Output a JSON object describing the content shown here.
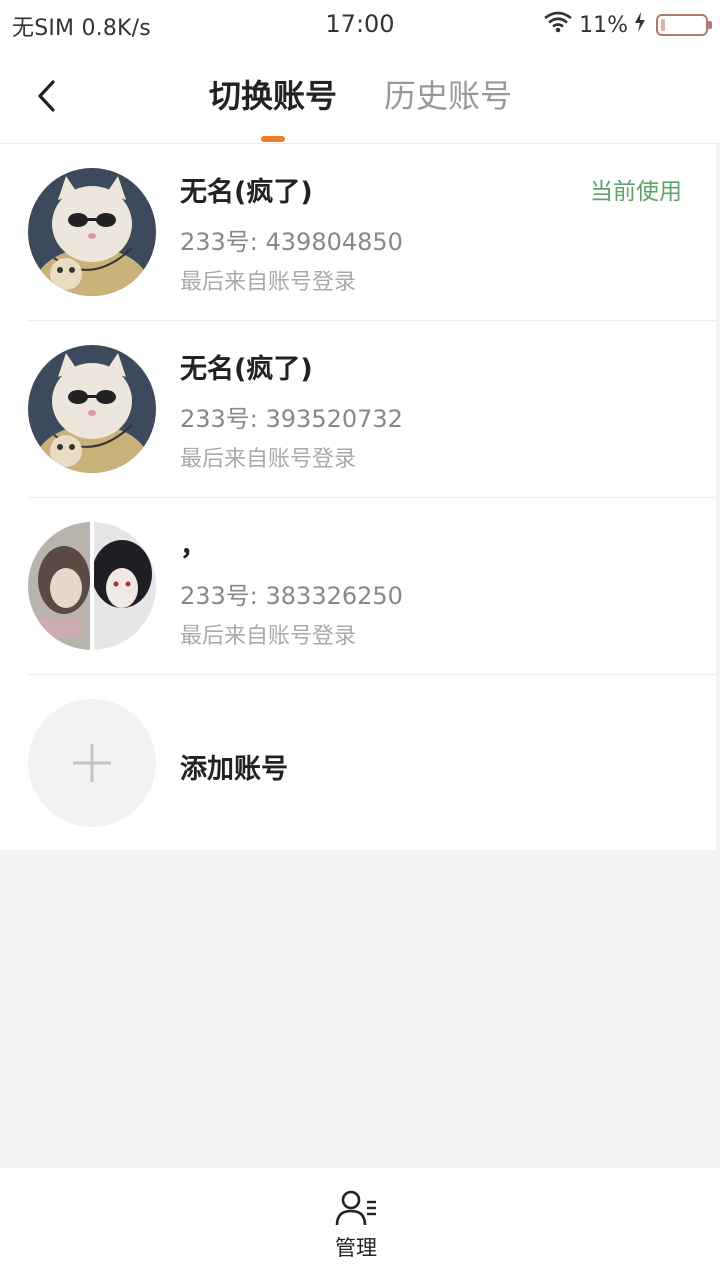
{
  "status_bar": {
    "carrier": "无SIM",
    "speed": "0.8K/s",
    "time": "17:00",
    "battery": "11%"
  },
  "header": {
    "tabs": [
      {
        "label": "切换账号",
        "active": true
      },
      {
        "label": "历史账号",
        "active": false
      }
    ],
    "accent_color": "#f07c2a"
  },
  "accounts": [
    {
      "name": "无名(疯了)",
      "uid": "233号: 439804850",
      "last_login": "最后来自账号登录",
      "current_label": "当前使用",
      "avatar": "cat-sunglasses-avatar"
    },
    {
      "name": "无名(疯了)",
      "uid": "233号: 393520732",
      "last_login": "最后来自账号登录",
      "avatar": "cat-sunglasses-avatar"
    },
    {
      "name": "，",
      "uid": "233号: 383326250",
      "last_login": "最后来自账号登录",
      "avatar": "anime-split-avatar"
    }
  ],
  "add_account": {
    "label": "添加账号"
  },
  "bottom": {
    "manage_label": "管理"
  },
  "colors": {
    "current": "#5fa26a",
    "background": "#f4f4f4"
  }
}
